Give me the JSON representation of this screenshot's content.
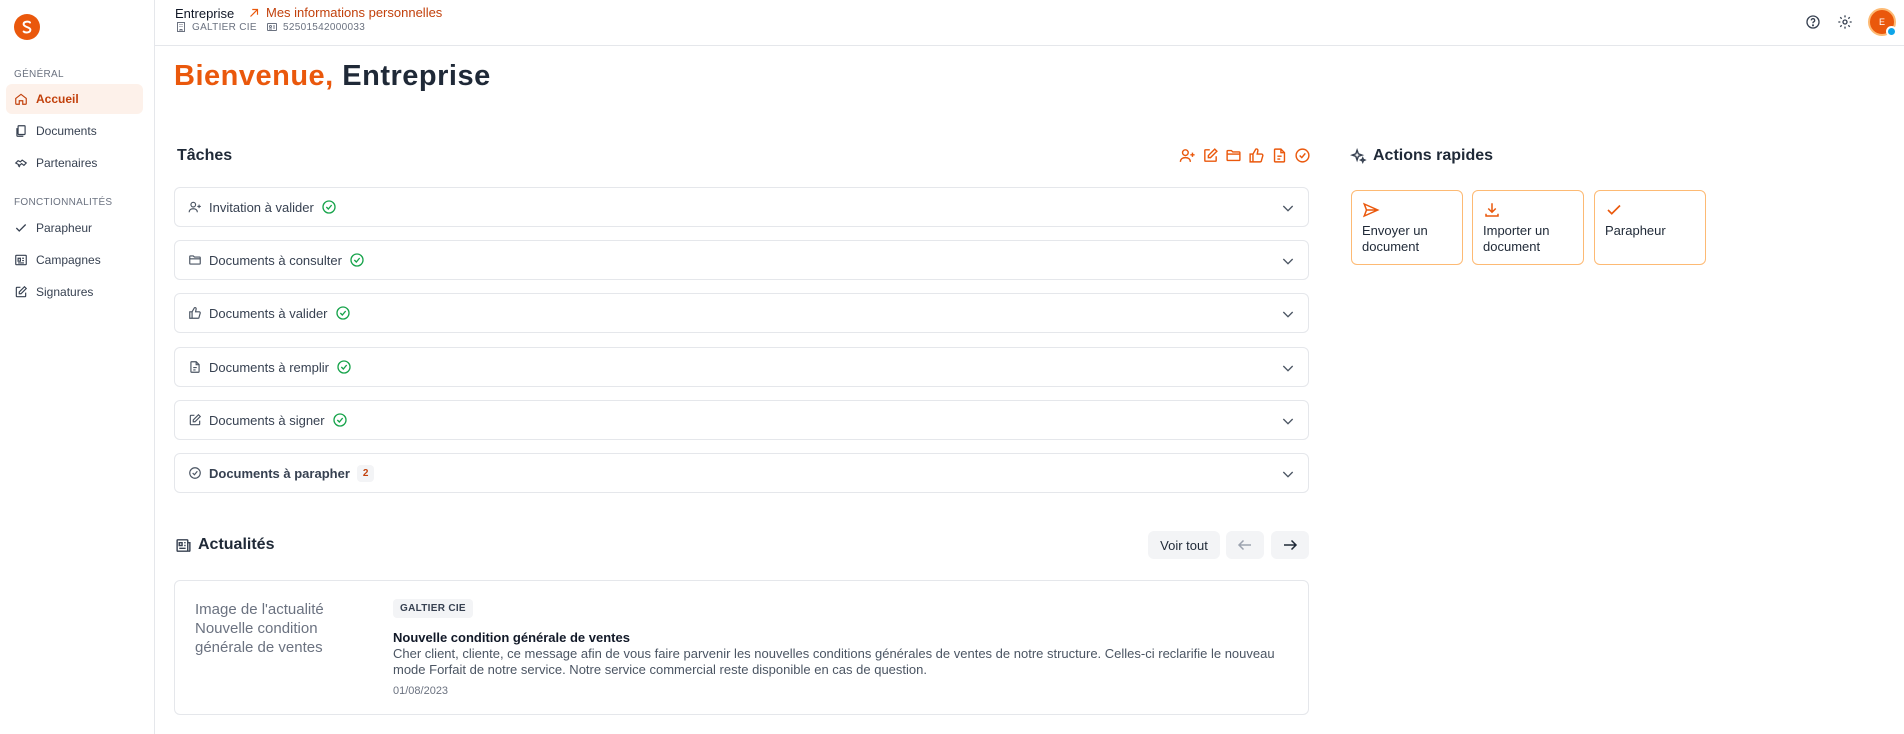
{
  "colors": {
    "accent": "#ea580c",
    "success": "#16a34a",
    "border": "#e5e7eb"
  },
  "topbar": {
    "name": "Entreprise",
    "personal_link": "Mes informations personnelles",
    "company": "GALTIER CIE",
    "siret": "52501542000033",
    "avatar_initial": "E"
  },
  "sidebar": {
    "section_general": "GÉNÉRAL",
    "section_features": "FONCTIONNALITÉS",
    "items": [
      {
        "label": "Accueil",
        "icon": "home-icon"
      },
      {
        "label": "Documents",
        "icon": "documents-icon"
      },
      {
        "label": "Partenaires",
        "icon": "partners-icon"
      },
      {
        "label": "Parapheur",
        "icon": "check-icon"
      },
      {
        "label": "Campagnes",
        "icon": "campaign-icon"
      },
      {
        "label": "Signatures",
        "icon": "signature-icon"
      }
    ]
  },
  "welcome": {
    "greeting": "Bienvenue,",
    "name": "Entreprise"
  },
  "tasks": {
    "title": "Tâches",
    "items": [
      {
        "label": "Invitation à valider",
        "icon": "user-plus-icon",
        "status": "done"
      },
      {
        "label": "Documents à consulter",
        "icon": "folder-icon",
        "status": "done"
      },
      {
        "label": "Documents à valider",
        "icon": "thumbs-up-icon",
        "status": "done"
      },
      {
        "label": "Documents à remplir",
        "icon": "file-icon",
        "status": "done"
      },
      {
        "label": "Documents à signer",
        "icon": "edit-icon",
        "status": "done"
      },
      {
        "label": "Documents à parapher",
        "icon": "circle-check-icon",
        "count": "2"
      }
    ]
  },
  "quick_actions": {
    "title": "Actions rapides",
    "items": [
      {
        "label": "Envoyer un document",
        "icon": "send-icon"
      },
      {
        "label": "Importer un document",
        "icon": "download-icon"
      },
      {
        "label": "Parapheur",
        "icon": "check-icon"
      }
    ]
  },
  "news": {
    "title": "Actualités",
    "see_all": "Voir tout",
    "item": {
      "image_alt": "Image de l'actualité Nouvelle condition générale de ventes",
      "tag": "GALTIER CIE",
      "title": "Nouvelle condition générale de ventes",
      "body": "Cher client, cliente, ce message afin de vous faire parvenir les nouvelles conditions générales de ventes de notre structure. Celles-ci reclarifie le nouveau mode Forfait de notre service. Notre service commercial reste disponible en cas de question.",
      "date": "01/08/2023"
    }
  }
}
